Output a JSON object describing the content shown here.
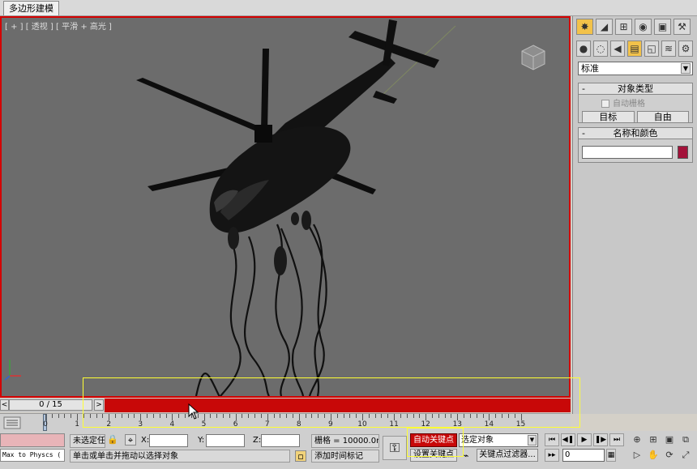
{
  "ribbon": {
    "tab_label": "多边形建模"
  },
  "viewport": {
    "label": "[ + ] [ 透视 ] [ 平滑 + 高光 ]",
    "accent_border": "#d40000",
    "background": "#6c6c6c"
  },
  "command_panel": {
    "tab_icons": [
      "create-icon",
      "modify-icon",
      "hierarchy-icon",
      "motion-icon",
      "display-icon",
      "utilities-icon"
    ],
    "category_icons": [
      "geometry-icon",
      "shapes-icon",
      "lights-icon",
      "cameras-icon",
      "helpers-icon",
      "spacewarps-icon",
      "systems-icon"
    ],
    "category_select": "标准",
    "object_type": {
      "title": "对象类型",
      "autogrid_label": "自动栅格",
      "btn_target": "目标",
      "btn_free": "自由"
    },
    "name_color": {
      "title": "名称和颜色",
      "name_value": "",
      "swatch_color": "#a3123a"
    }
  },
  "time_slider": {
    "label": "0 / 15",
    "left_arrow": "<",
    "right_arrow": ">",
    "track_color": "#c80808"
  },
  "trackbar": {
    "tick_labels": [
      "0",
      "1",
      "2",
      "3",
      "4",
      "5",
      "6",
      "7",
      "8",
      "9",
      "10",
      "11",
      "12",
      "13",
      "14",
      "15"
    ]
  },
  "status_bar": {
    "maxscript_text": "Max to Physcs (",
    "selection_status": "未选定任何对象",
    "prompt": "单击或单击并拖动以选择对象",
    "x_label": "X:",
    "y_label": "Y:",
    "z_label": "Z:",
    "x_value": "",
    "y_value": "",
    "z_value": "",
    "grid": "栅格 = 10000.0mm",
    "add_time_tag": "添加时间标记",
    "auto_key": "自动关键点",
    "set_key": "设置关键点",
    "selection_filter": "选定对象",
    "key_filters": "关键点过滤器...",
    "current_frame": "0",
    "playback_icons": [
      "go-to-start",
      "previous-frame",
      "play",
      "next-frame",
      "go-to-end"
    ]
  }
}
